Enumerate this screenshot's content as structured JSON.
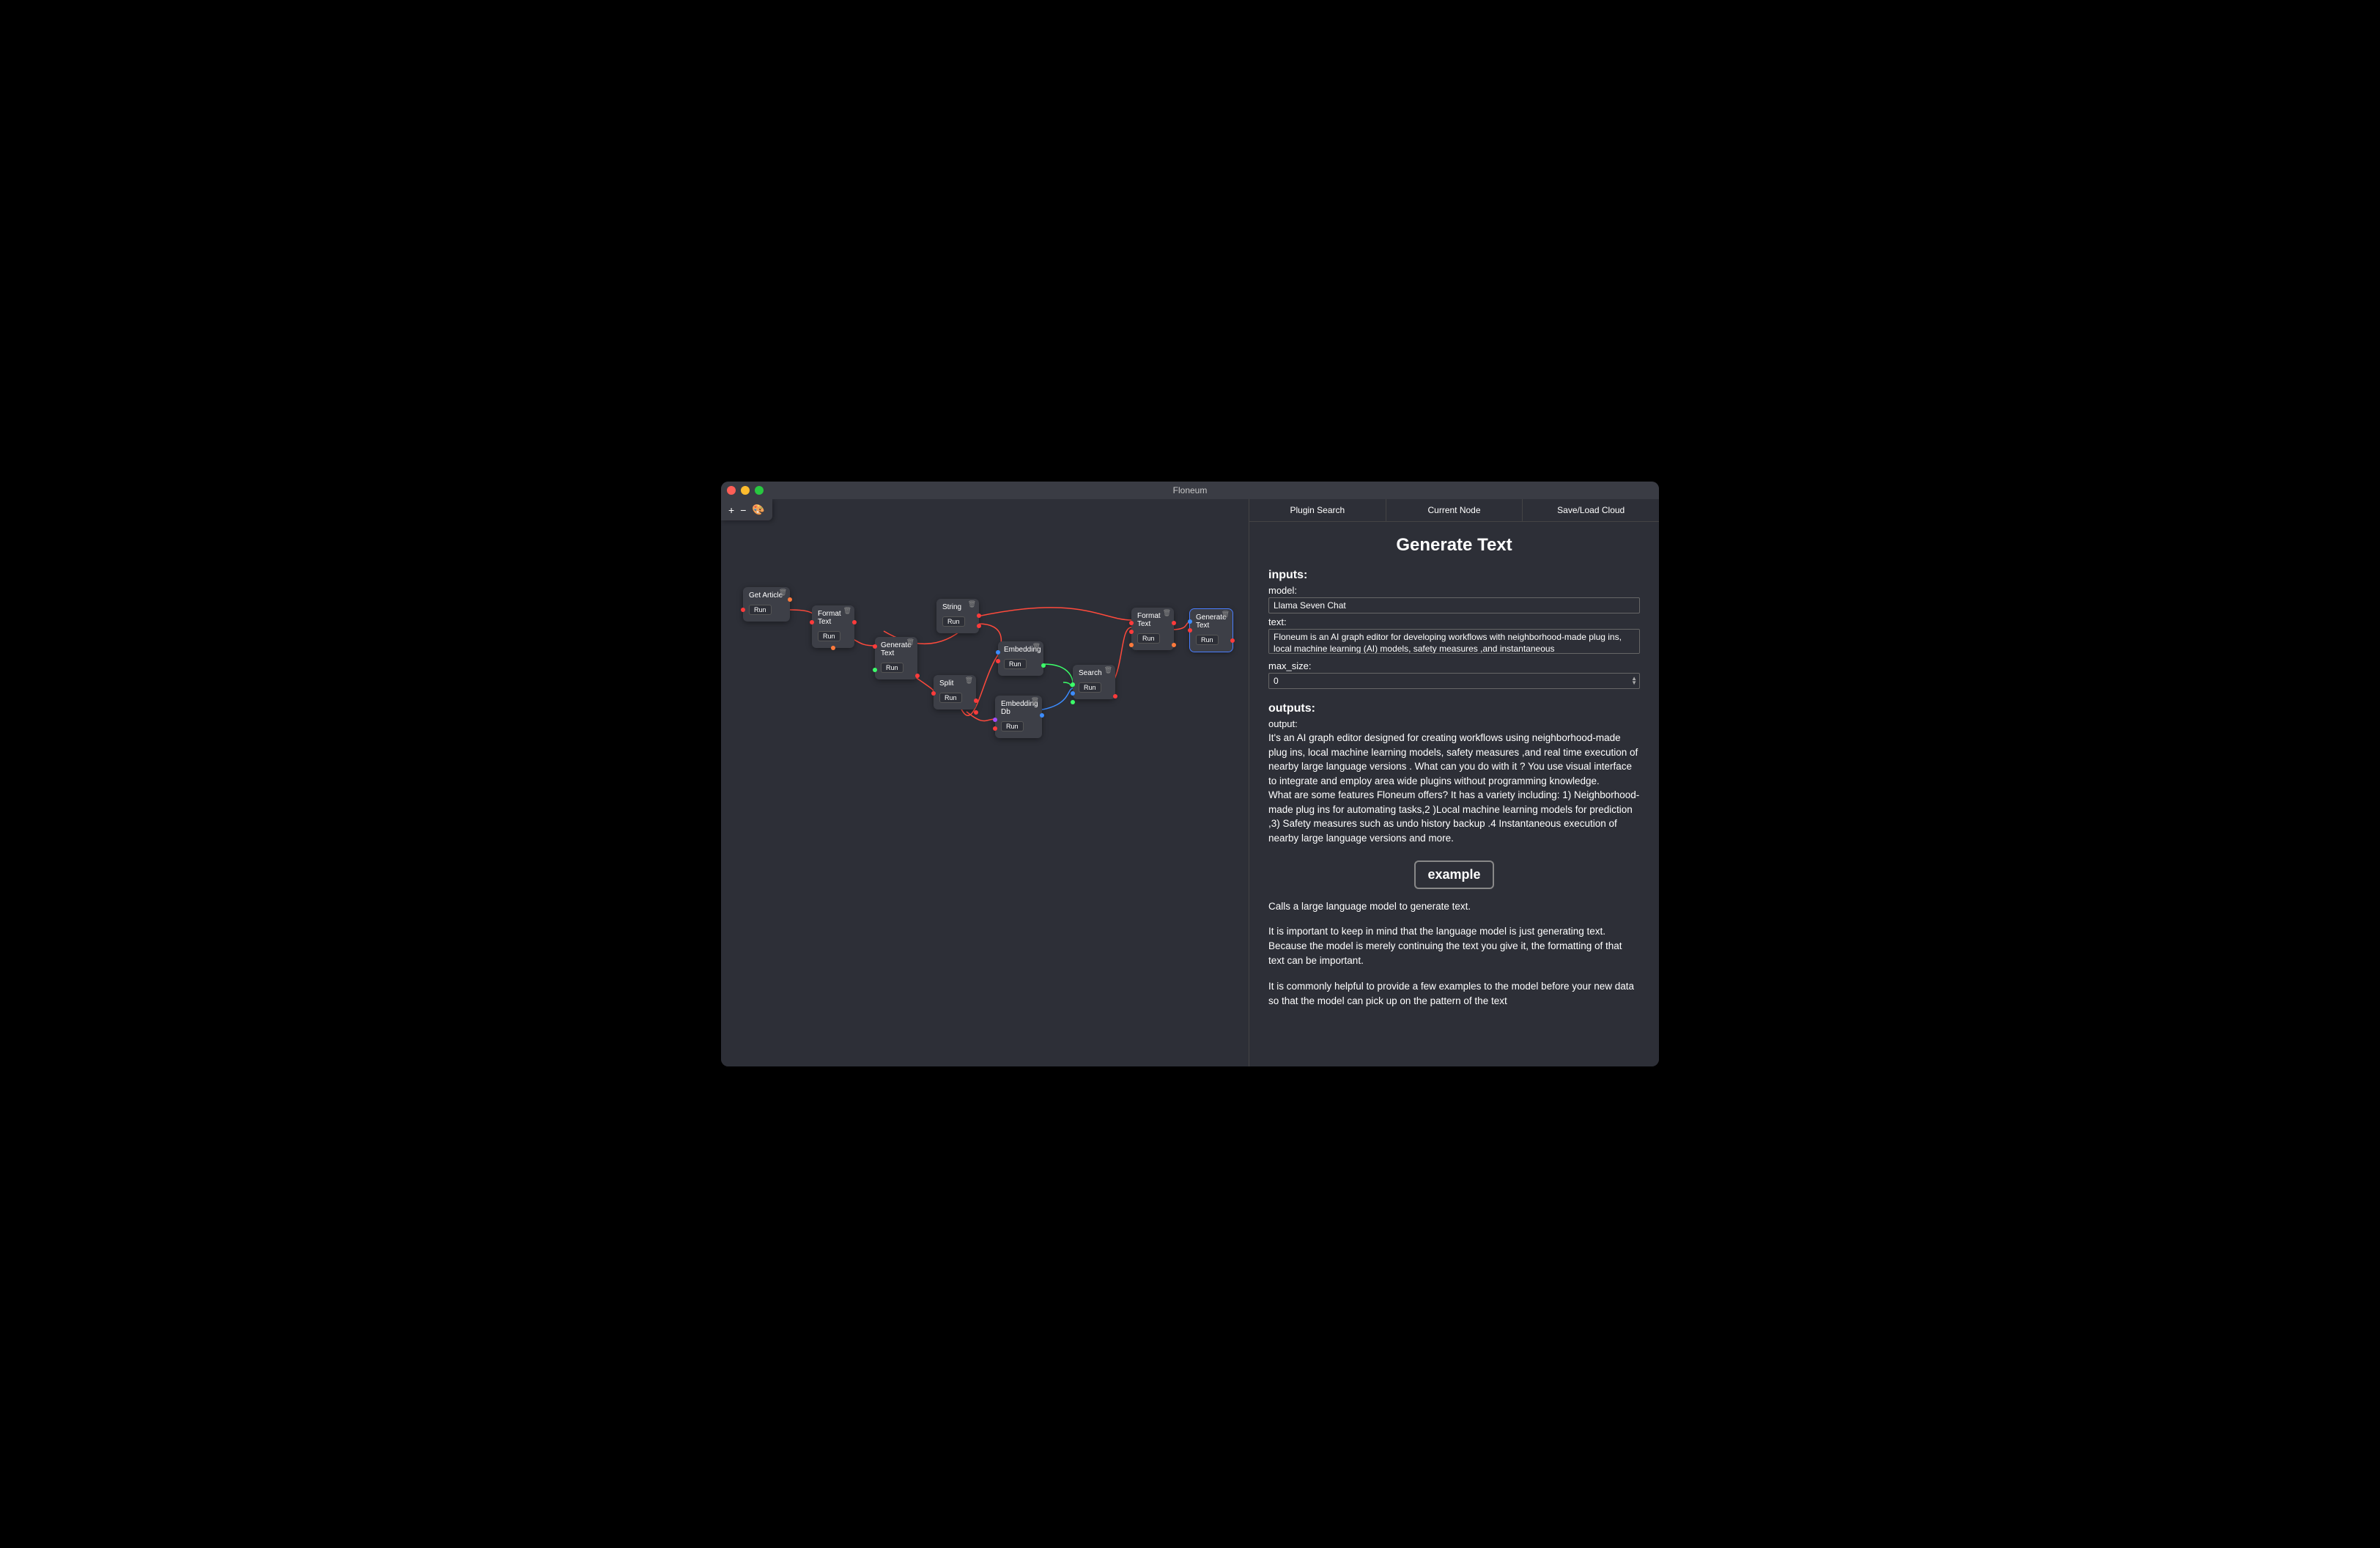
{
  "window": {
    "title": "Floneum"
  },
  "toolbar": {
    "plus": "+",
    "minus": "−",
    "color": "🎨"
  },
  "nodes": {
    "get_article": {
      "title": "Get Article",
      "run": "Run"
    },
    "format_text_1": {
      "title": "Format\nText",
      "run": "Run"
    },
    "generate_text_1": {
      "title": "Generate\nText",
      "run": "Run"
    },
    "split": {
      "title": "Split",
      "run": "Run"
    },
    "string": {
      "title": "String",
      "run": "Run"
    },
    "embedding": {
      "title": "Embedding",
      "run": "Run"
    },
    "embedding_db": {
      "title": "Embedding\nDb",
      "run": "Run"
    },
    "search": {
      "title": "Search",
      "run": "Run"
    },
    "format_text_2": {
      "title": "Format\nText",
      "run": "Run"
    },
    "generate_text_2": {
      "title": "Generate\nText",
      "run": "Run"
    }
  },
  "tabs": {
    "plugin_search": "Plugin Search",
    "current_node": "Current Node",
    "save_load": "Save/Load Cloud"
  },
  "panel": {
    "title": "Generate Text",
    "inputs_head": "inputs:",
    "model_label": "model:",
    "model_value": "Llama Seven Chat",
    "text_label": "text:",
    "text_value": "Floneum is an AI graph editor for developing workflows with neighborhood-made plug ins, local machine learning (AI) models, safety measures ,and instantaneous",
    "max_size_label": "max_size:",
    "max_size_value": "0",
    "outputs_head": "outputs:",
    "output_label": "output:",
    "output_p1": "It's an AI graph editor designed for creating workflows using neighborhood-made plug ins, local machine learning models, safety measures ,and real time execution of nearby large language versions . What can you do with it ? You use visual interface to integrate and employ area wide plugins without programming knowledge.",
    "output_p2": "What are some features Floneum offers? It has a variety including: 1) Neighborhood-made plug ins for automating tasks,2 )Local machine learning models for prediction ,3) Safety measures such as undo history backup .4 Instantaneous execution of nearby large language versions and more.",
    "example_btn": "example",
    "desc1": "Calls a large language model to generate text.",
    "desc2": "It is important to keep in mind that the language model is just generating text. Because the model is merely continuing the text you give it, the formatting of that text can be important.",
    "desc3": "It is commonly helpful to provide a few examples to the model before your new data so that the model can pick up on the pattern of the text"
  }
}
